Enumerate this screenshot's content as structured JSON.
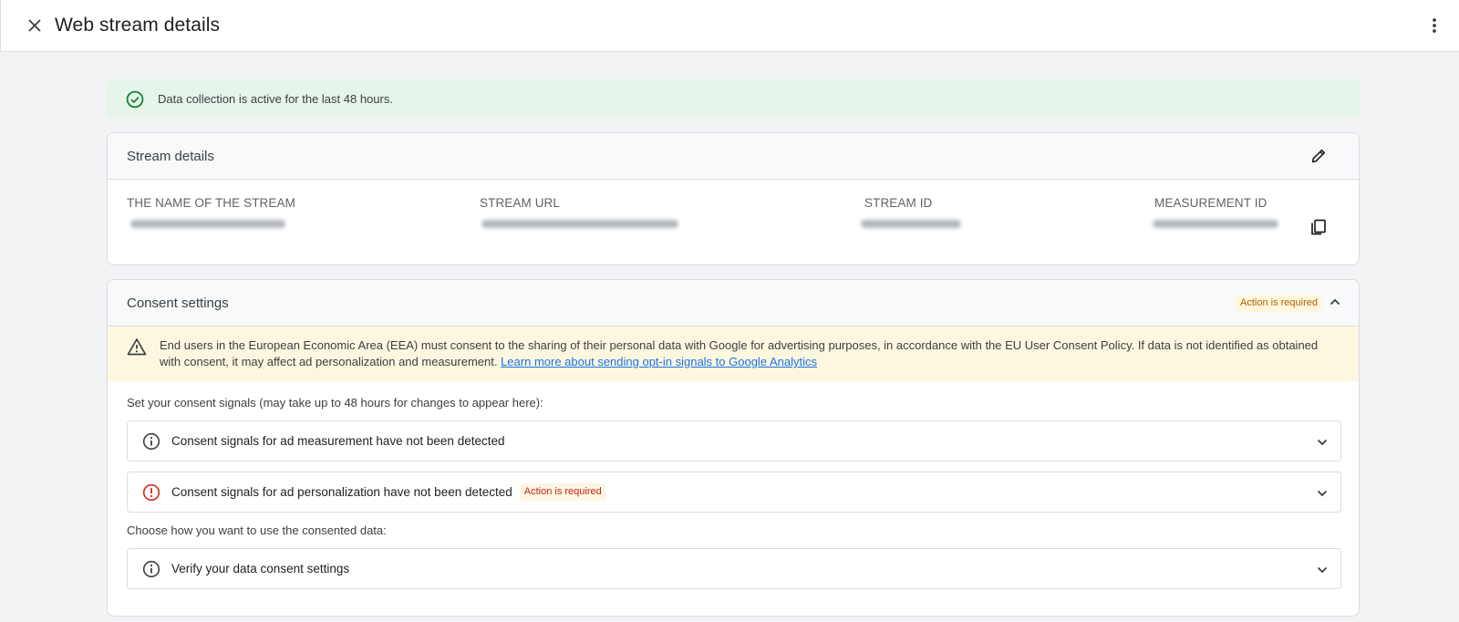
{
  "header": {
    "title": "Web stream details"
  },
  "status_banner": {
    "text": "Data collection is active for the last 48 hours."
  },
  "stream_details": {
    "title": "Stream details",
    "fields": [
      {
        "label": "THE NAME OF THE STREAM"
      },
      {
        "label": "STREAM URL"
      },
      {
        "label": "STREAM ID"
      },
      {
        "label": "MEASUREMENT ID"
      }
    ]
  },
  "consent": {
    "title": "Consent settings",
    "badge": "Action is required",
    "warning_text": "End users in the European Economic Area (EEA) must consent to the sharing of their personal data with Google for advertising purposes, in accordance with the EU User Consent Policy. If data is not identified as obtained with consent, it may affect ad personalization and measurement. ",
    "warning_link": "Learn more about sending opt-in signals to Google Analytics",
    "hint1": "Set your consent signals (may take up to 48 hours for changes to appear here):",
    "items": [
      {
        "label": "Consent signals for ad measurement have not been detected"
      },
      {
        "label": "Consent signals for ad personalization have not been detected",
        "badge": "Action is required"
      }
    ],
    "hint2": "Choose how you want to use the consented data:",
    "verify_item": {
      "label": "Verify your data consent settings"
    }
  },
  "colors": {
    "success_bg": "#e6f4ea",
    "success_icon": "#188038",
    "warning_bg": "#fef7e0",
    "error_icon": "#d93025",
    "link": "#1a73e8"
  }
}
